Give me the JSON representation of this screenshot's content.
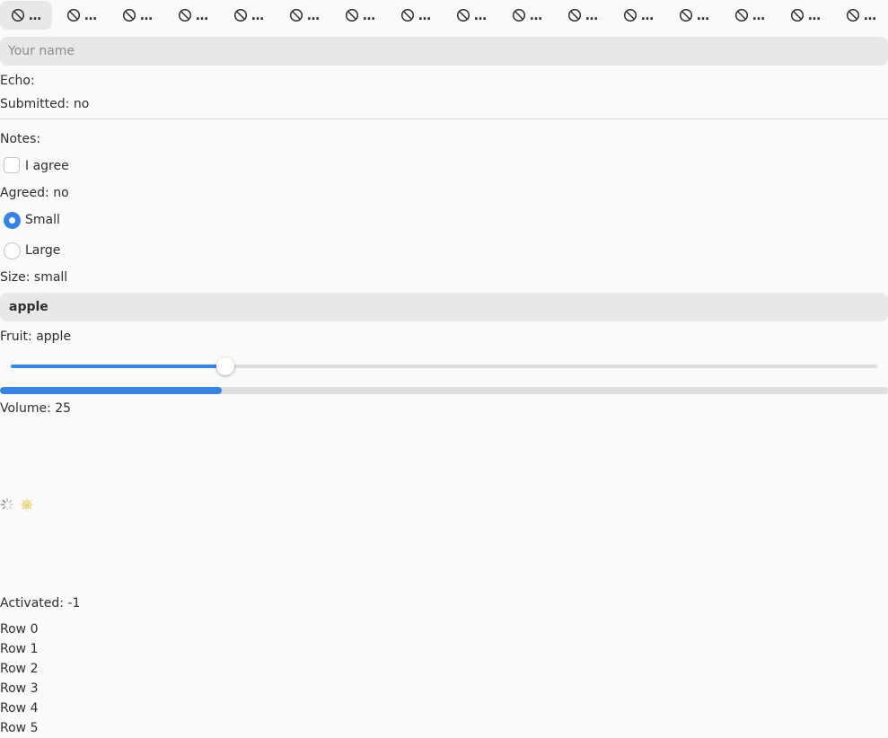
{
  "tabs": [
    {
      "label": "…",
      "icon": "prohibited-icon"
    },
    {
      "label": "…",
      "icon": "prohibited-icon"
    },
    {
      "label": "…",
      "icon": "prohibited-icon"
    },
    {
      "label": "…",
      "icon": "prohibited-icon"
    },
    {
      "label": "…",
      "icon": "prohibited-icon"
    },
    {
      "label": "…",
      "icon": "prohibited-icon"
    },
    {
      "label": "…",
      "icon": "prohibited-icon"
    },
    {
      "label": "…",
      "icon": "prohibited-icon"
    },
    {
      "label": "…",
      "icon": "prohibited-icon"
    },
    {
      "label": "…",
      "icon": "prohibited-icon"
    },
    {
      "label": "…",
      "icon": "prohibited-icon"
    },
    {
      "label": "…",
      "icon": "prohibited-icon"
    },
    {
      "label": "…",
      "icon": "prohibited-icon"
    },
    {
      "label": "…",
      "icon": "prohibited-icon"
    },
    {
      "label": "…",
      "icon": "prohibited-icon"
    },
    {
      "label": "…",
      "icon": "prohibited-icon"
    }
  ],
  "name_input": {
    "value": "",
    "placeholder": "Your name"
  },
  "echo_label": "Echo:",
  "submitted_label": "Submitted: no",
  "notes_label": "Notes:",
  "agree_checkbox": {
    "label": "I agree",
    "checked": false
  },
  "agreed_label": "Agreed: no",
  "size_radios": [
    {
      "label": "Small",
      "selected": true
    },
    {
      "label": "Large",
      "selected": false
    }
  ],
  "size_label": "Size: small",
  "fruit_dropdown": {
    "selected": "apple"
  },
  "fruit_label": "Fruit: apple",
  "volume_slider": {
    "value": 25,
    "min": 0,
    "max": 100
  },
  "volume_progress": {
    "fraction": 0.25
  },
  "volume_label": "Volume: 25",
  "activated_label": "Activated: -1",
  "rows": [
    "Row 0",
    "Row 1",
    "Row 2",
    "Row 3",
    "Row 4",
    "Row 5"
  ],
  "colors": {
    "accent": "#3584e4",
    "background": "#fafafa",
    "field": "#e8e8e8"
  }
}
